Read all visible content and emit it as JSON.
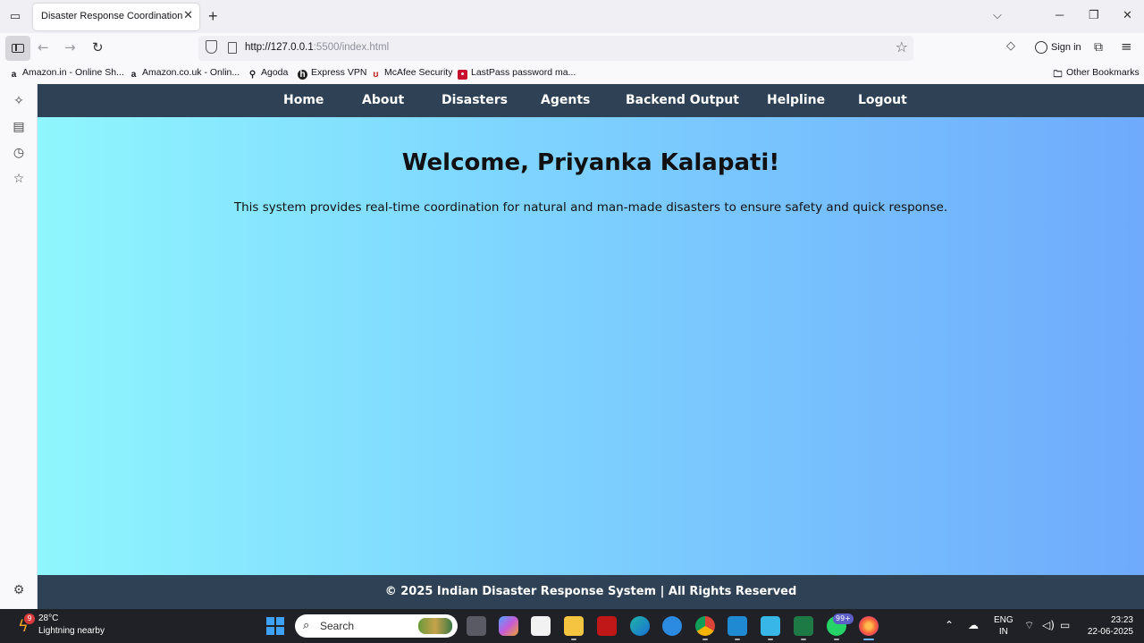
{
  "browser": {
    "tab_title": "Disaster Response Coordination System",
    "url_host": "http://127.0.0.1",
    "url_rest": ":5500/index.html",
    "sign_in_label": "Sign in",
    "bookmarks": [
      "Amazon.in - Online Sh...",
      "Amazon.co.uk - Onlin...",
      "Agoda",
      "Express VPN",
      "McAfee Security",
      "LastPass password ma..."
    ],
    "other_bookmarks": "Other Bookmarks"
  },
  "site": {
    "nav": [
      "Home",
      "About",
      "Disasters",
      "Agents",
      "Backend Output",
      "Helpline",
      "Logout"
    ],
    "welcome": "Welcome, Priyanka Kalapati!",
    "intro": "This system provides real-time coordination for natural and man-made disasters to ensure safety and quick response.",
    "footer": "© 2025 Indian Disaster Response System | All Rights Reserved",
    "colors": {
      "nav_bg": "#2f4255",
      "gradient_start": "#8ff6fd",
      "gradient_end": "#6faafc"
    }
  },
  "taskbar": {
    "weather_badge": "9",
    "temperature": "28°C",
    "weather_desc": "Lightning nearby",
    "search_label": "Search",
    "whatsapp_badge": "99+",
    "lang_1": "ENG",
    "lang_2": "IN",
    "time": "23:23",
    "date": "22-06-2025"
  }
}
